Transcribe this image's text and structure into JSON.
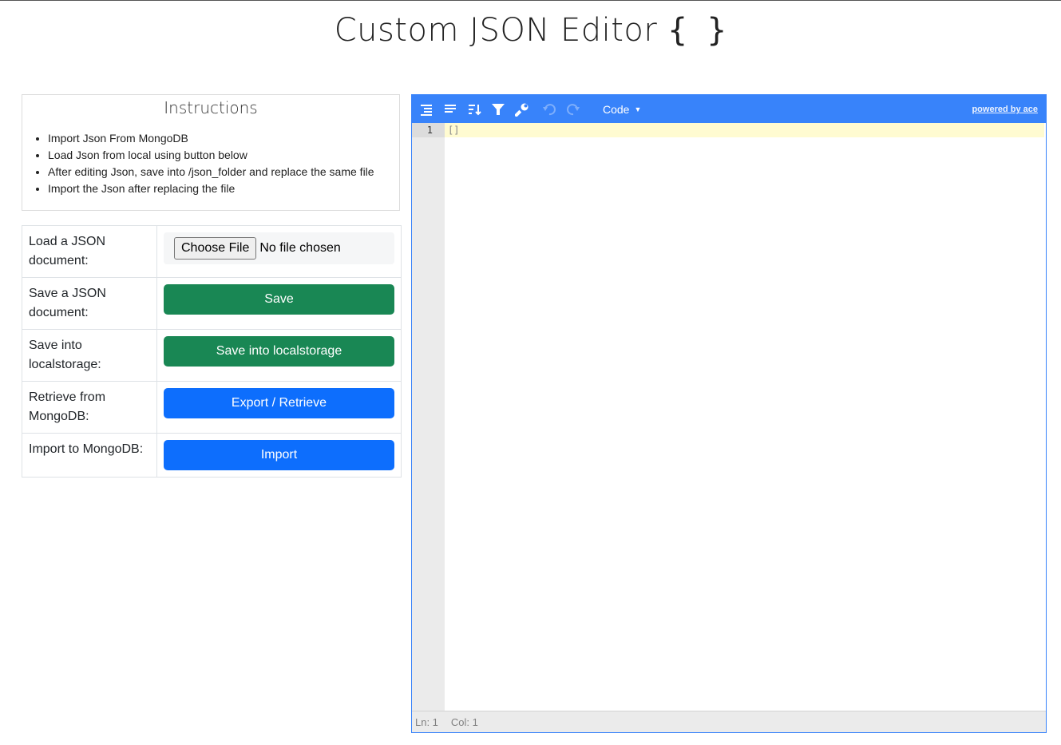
{
  "page": {
    "title": "Custom JSON Editor",
    "title_braces": "{ }"
  },
  "instructions": {
    "heading": "Instructions",
    "items": [
      "Import Json From MongoDB",
      "Load Json from local using button below",
      "After editing Json, save into /json_folder and replace the same file",
      "Import the Json after replacing the file"
    ]
  },
  "controls": {
    "load_label": "Load a JSON document:",
    "file_button": "Choose File",
    "file_status": "No file chosen",
    "save_label": "Save a JSON document:",
    "save_button": "Save",
    "localstorage_label": "Save into localstorage:",
    "localstorage_button": "Save into localstorage",
    "retrieve_label": "Retrieve from MongoDB:",
    "retrieve_button": "Export / Retrieve",
    "import_label": "Import to MongoDB:",
    "import_button": "Import"
  },
  "editor": {
    "toolbar_icons": [
      "format-icon",
      "compact-icon",
      "sort-icon",
      "filter-icon",
      "repair-icon",
      "undo-icon",
      "redo-icon"
    ],
    "mode": "Code",
    "powered_by": "powered by ace",
    "line_number": "1",
    "content": "[]",
    "status_ln": "Ln: 1",
    "status_col": "Col: 1"
  },
  "colors": {
    "accent_blue": "#3883fa",
    "button_green": "#198754",
    "button_blue": "#0d6efd"
  }
}
